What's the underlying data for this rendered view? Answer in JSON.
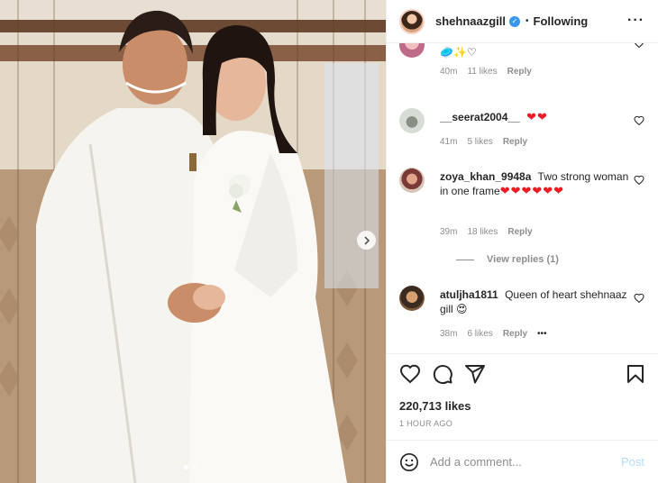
{
  "header": {
    "username": "shehnaazgill",
    "separator": "•",
    "follow_status": "Following",
    "more_icon": "more-horizontal-icon"
  },
  "comments": [
    {
      "username": "",
      "text": "",
      "emoji": "🥏✨♡",
      "time": "40m",
      "likes": "11 likes",
      "reply": "Reply"
    },
    {
      "username": "__seerat2004__",
      "text": "",
      "emoji": "❤❤",
      "time": "41m",
      "likes": "5 likes",
      "reply": "Reply"
    },
    {
      "username": "zoya_khan_9948a",
      "text": "Two strong woman in one frame",
      "emoji": "❤❤❤❤❤❤",
      "time": "39m",
      "likes": "18 likes",
      "reply": "Reply",
      "view_replies": "View replies (1)"
    },
    {
      "username": "atuljha1811",
      "text": "Queen of heart shehnaaz gill",
      "emoji": "😍",
      "time": "38m",
      "likes": "6 likes",
      "reply": "Reply",
      "more": "•••"
    }
  ],
  "actions": {
    "like_icon": "heart-icon",
    "comment_icon": "comment-icon",
    "share_icon": "send-icon",
    "save_icon": "bookmark-icon",
    "likes_count": "220,713 likes",
    "posted_ago": "1 HOUR AGO"
  },
  "add_comment": {
    "placeholder": "Add a comment...",
    "post_label": "Post",
    "emoji_icon": "smiley-icon"
  },
  "carousel": {
    "next_icon": "chevron-right-icon",
    "total_slides": 2,
    "active_slide": 1
  },
  "colors": {
    "verified": "#3897f0",
    "heart": "#ed1c24",
    "muted": "#8e8e8e",
    "post_disabled": "#b2dffc"
  }
}
